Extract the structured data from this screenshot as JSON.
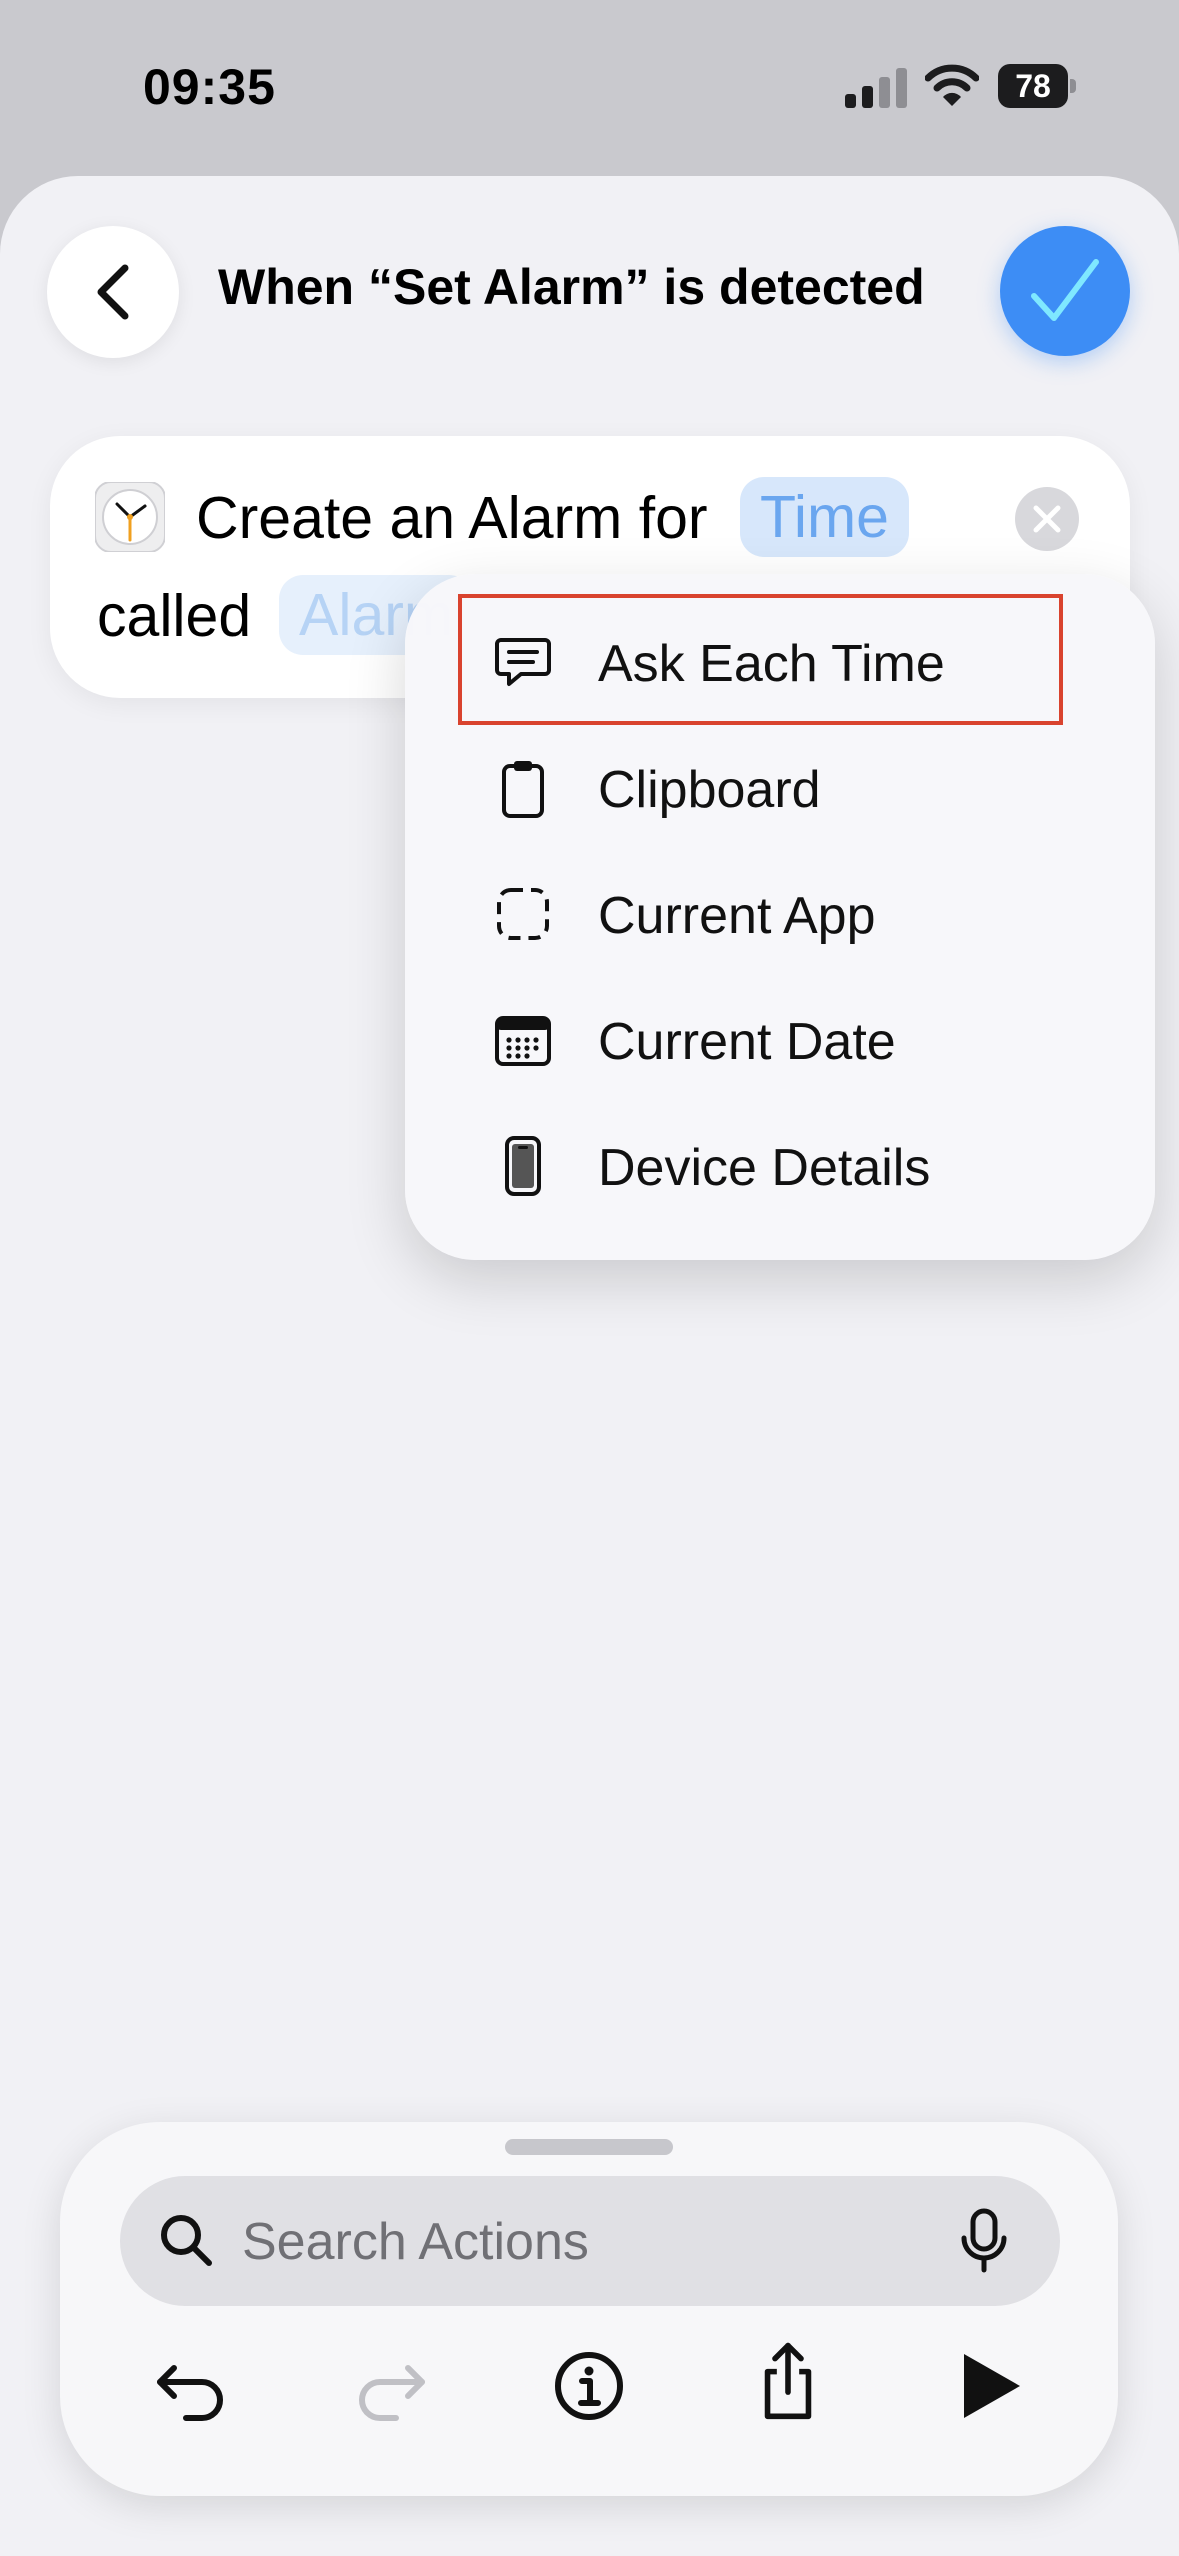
{
  "status_bar": {
    "time": "09:35",
    "battery": "78",
    "icons": [
      "cellular-signal-icon",
      "wifi-icon",
      "battery-icon"
    ]
  },
  "header": {
    "title": "When “Set Alarm” is detected",
    "back_icon": "chevron-left-icon",
    "done_icon": "checkmark-icon",
    "accent_color": "#3d8df5"
  },
  "action": {
    "icon": "clock-app-icon",
    "text_before": "Create an Alarm for",
    "time_token": "Time",
    "text_called": "called",
    "label_token": "Alarm",
    "clear_icon": "xmark-icon"
  },
  "menu": {
    "items": [
      {
        "label": "Ask Each Time",
        "icon": "speech-bubble-icon"
      },
      {
        "label": "Clipboard",
        "icon": "clipboard-icon"
      },
      {
        "label": "Current App",
        "icon": "dashed-square-icon"
      },
      {
        "label": "Current Date",
        "icon": "calendar-icon"
      },
      {
        "label": "Device Details",
        "icon": "iphone-icon"
      }
    ],
    "highlight_color": "#d9432e"
  },
  "toolbar": {
    "search_placeholder": "Search Actions",
    "buttons": [
      "undo-icon",
      "redo-icon",
      "info-icon",
      "share-icon",
      "play-icon"
    ]
  }
}
